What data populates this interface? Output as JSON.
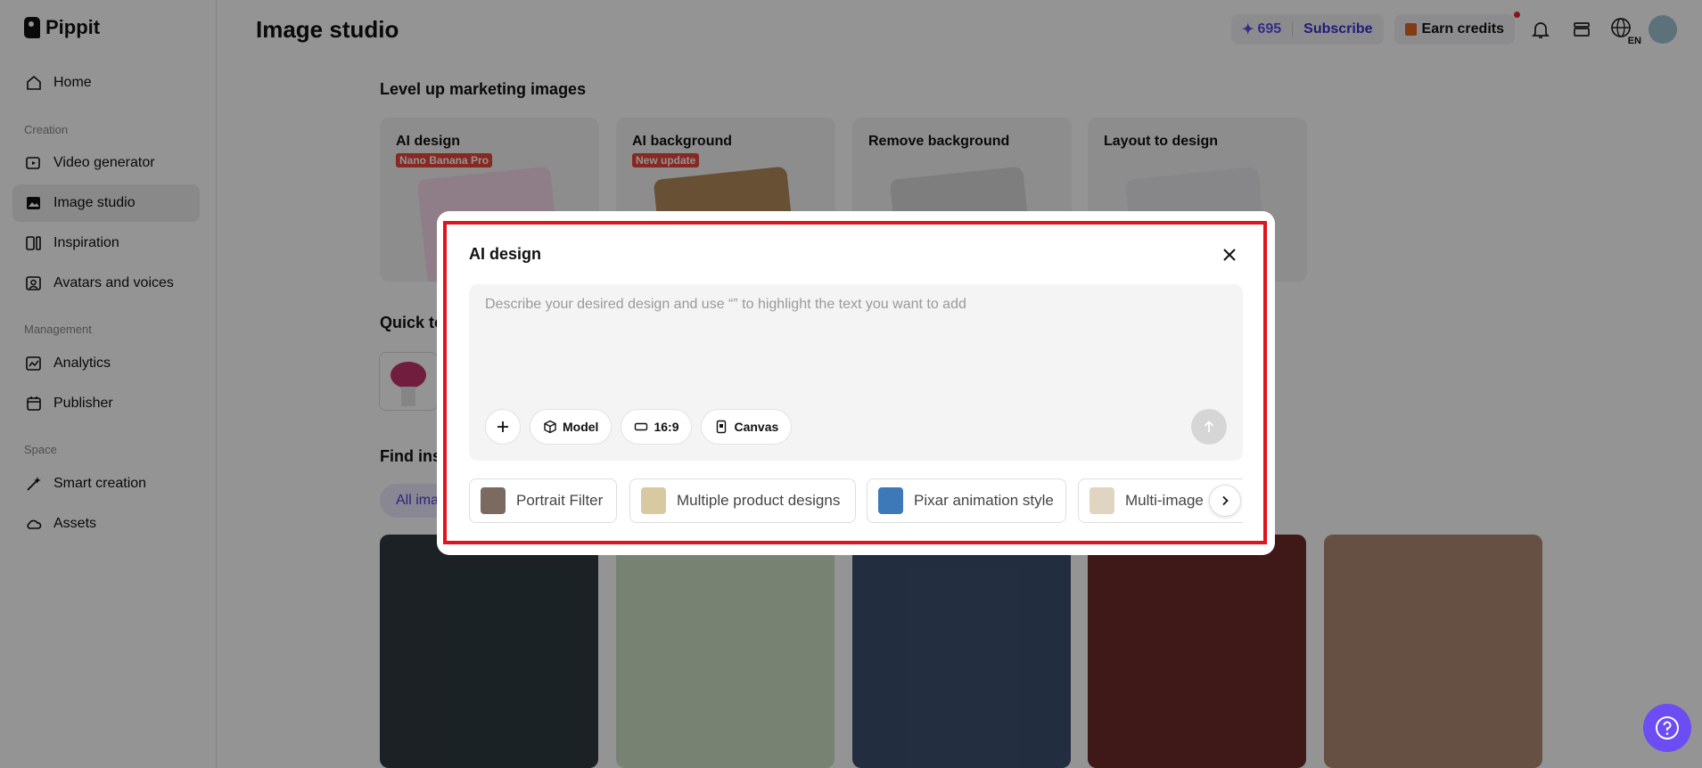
{
  "app": {
    "name": "Pippit"
  },
  "sidebar": {
    "items": [
      {
        "label": "Home",
        "icon": "home-icon"
      },
      {
        "label": "Video generator",
        "icon": "video-icon"
      },
      {
        "label": "Image studio",
        "icon": "image-icon",
        "active": true
      },
      {
        "label": "Inspiration",
        "icon": "inspiration-icon"
      },
      {
        "label": "Avatars and voices",
        "icon": "avatar-icon"
      },
      {
        "label": "Analytics",
        "icon": "analytics-icon"
      },
      {
        "label": "Publisher",
        "icon": "calendar-icon"
      },
      {
        "label": "Smart creation",
        "icon": "wand-icon"
      },
      {
        "label": "Assets",
        "icon": "cloud-icon"
      }
    ],
    "sections": {
      "creation": "Creation",
      "management": "Management",
      "space": "Space"
    }
  },
  "header": {
    "title": "Image studio",
    "credits_symbol": "✦",
    "credits": "695",
    "subscribe": "Subscribe",
    "earn_credits": "Earn credits",
    "language": "EN"
  },
  "main": {
    "section_marketing": "Level up marketing images",
    "tools": [
      {
        "title": "AI design",
        "badge": "Nano Banana Pro"
      },
      {
        "title": "AI background",
        "badge": "New update"
      },
      {
        "title": "Remove background",
        "badge": ""
      },
      {
        "title": "Layout to design",
        "badge": ""
      }
    ],
    "section_quick": "Quick to",
    "section_find": "Find ins",
    "filter_chip": "All ima"
  },
  "modal": {
    "title": "AI design",
    "prompt_value": "",
    "prompt_placeholder": "Describe your desired design and use “” to highlight the text you want to add",
    "toolbar": {
      "model_label": "Model",
      "ratio_label": "16:9",
      "canvas_label": "Canvas"
    },
    "suggestions": [
      {
        "label": "Portrait Filter"
      },
      {
        "label": "Multiple product designs"
      },
      {
        "label": "Pixar animation style"
      },
      {
        "label": "Multi-image"
      }
    ]
  },
  "colors": {
    "accent": "#5b4ce6",
    "highlight_border": "#e0141f",
    "badge_red": "#e5483b",
    "help_button": "#6c4cf3"
  }
}
